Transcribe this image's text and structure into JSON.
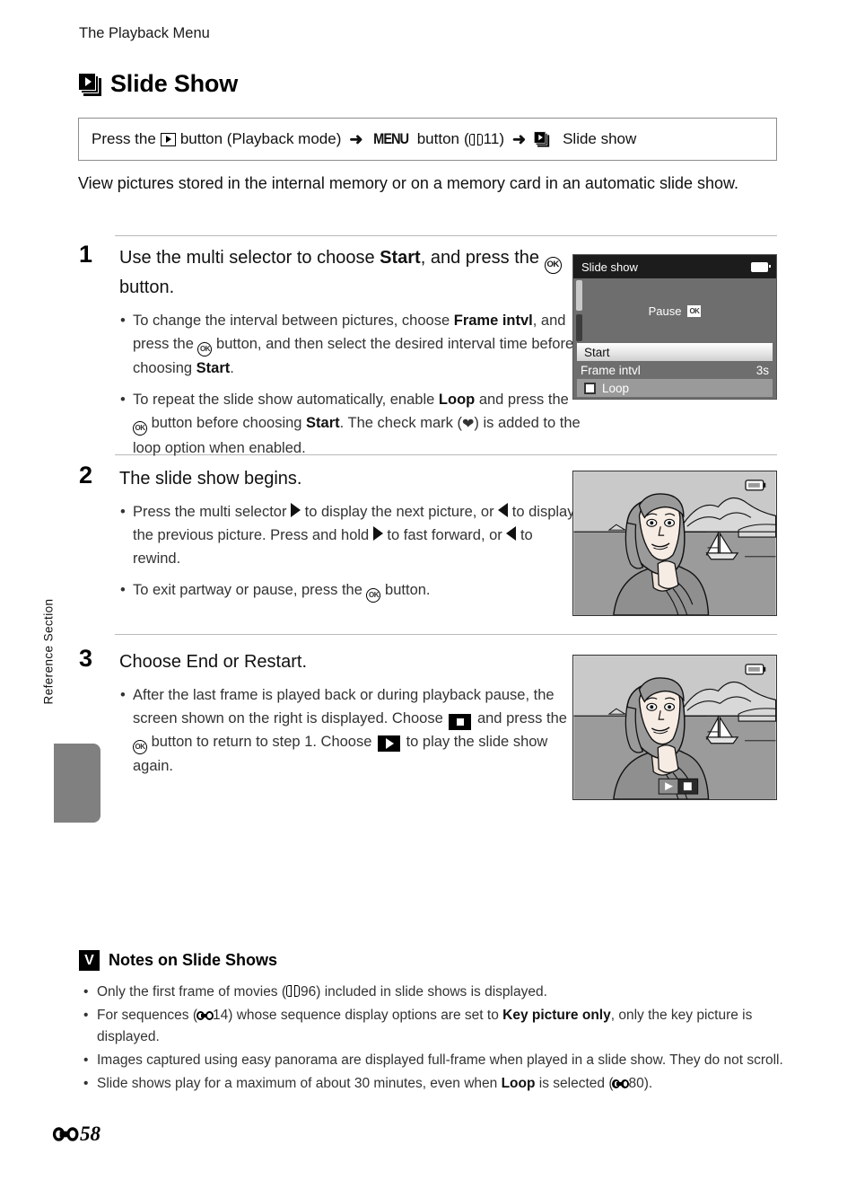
{
  "page": {
    "running_head": "The Playback Menu",
    "title": "Slide Show",
    "title_icon": "slideshow-icon",
    "folio": "58",
    "folio_icon": "e-symbol-icon",
    "side_tab_label": "Reference Section"
  },
  "command_path": {
    "prefix": "Press the",
    "play_icon": "playback-button-icon",
    "after_play": "button (Playback mode)",
    "arrow1": "➜",
    "menu_word": "MENU",
    "menu_suffix": "button",
    "ref_open": "(",
    "ref_book_icon": "book-icon",
    "ref_page": "11",
    "ref_close": ")",
    "arrow2": "➜",
    "slideshow_icon": "slideshow-icon",
    "target": "Slide show"
  },
  "intro": "View pictures stored in the internal memory or on a memory card in an automatic slide show.",
  "steps": [
    {
      "number": "1",
      "heading_pre": "Use the multi selector to choose ",
      "heading_bold": "Start",
      "heading_mid": ", and press the ",
      "heading_icon": "ok-button-icon",
      "heading_post": " button.",
      "bullets": [
        "To change the interval between pictures, choose Frame intvl, and press the OK button, and then select the desired interval time before choosing Start.",
        "To repeat the slide show automatically, enable Loop and press the OK button before choosing Start. The check mark (✔) is added to the loop option when enabled."
      ]
    },
    {
      "number": "2",
      "heading": "The slide show begins.",
      "bullets": [
        "Press the multi selector ▶ to display the next picture, or ◀ to display the previous picture. Press and hold ▶ to fast forward, or ◀ to rewind.",
        "To exit partway or pause, press the OK button."
      ]
    },
    {
      "number": "3",
      "heading": "Choose End or Restart.",
      "bullets": [
        "After the last frame is played back or during playback pause, the screen shown on the right is displayed. Choose [stop] and press the OK button to return to step 1. Choose [play] to play the slide show again."
      ]
    }
  ],
  "lcd": {
    "title": "Slide show",
    "battery_icon": "battery-icon",
    "pause_label": "Pause",
    "pause_ok_icon": "ok-badge-icon",
    "rows": [
      {
        "label": "Start",
        "value": "",
        "state": "selected"
      },
      {
        "label": "Frame intvl",
        "value": "3s",
        "state": "normal"
      },
      {
        "label": "Loop",
        "value": "",
        "state": "checkbox"
      }
    ]
  },
  "photos": {
    "step2": {
      "battery_icon": "battery-icon",
      "alt": "woman-with-sailboat-scene"
    },
    "step3": {
      "battery_icon": "battery-icon",
      "alt": "woman-with-sailboat-scene",
      "controls": [
        "play-icon",
        "stop-icon"
      ]
    }
  },
  "notes": {
    "icon": "caution-v-icon",
    "title": "Notes on Slide Shows",
    "items": [
      {
        "parts": [
          {
            "t": "Only the first frame of movies ("
          },
          {
            "icon": "book-icon"
          },
          {
            "t": "96) included in slide shows is displayed."
          }
        ]
      },
      {
        "parts": [
          {
            "t": "For sequences ("
          },
          {
            "icon": "e-symbol-icon"
          },
          {
            "t": "14) whose sequence display options are set to "
          },
          {
            "b": "Key picture only"
          },
          {
            "t": ", only the key picture is displayed."
          }
        ]
      },
      {
        "parts": [
          {
            "t": "Images captured using easy panorama are displayed full-frame when played in a slide show. They do not scroll."
          }
        ]
      },
      {
        "parts": [
          {
            "t": "Slide shows play for a maximum of about 30 minutes, even when "
          },
          {
            "b": "Loop"
          },
          {
            "t": " is selected ("
          },
          {
            "icon": "e-symbol-icon"
          },
          {
            "t": "80)."
          }
        ]
      }
    ]
  },
  "colors": {
    "lcd_header": "#1c1c1c",
    "lcd_body": "#6e6e6e",
    "tab_gray": "#808080",
    "rule": "#b9b9b9",
    "box_border": "#8d8d8d"
  }
}
